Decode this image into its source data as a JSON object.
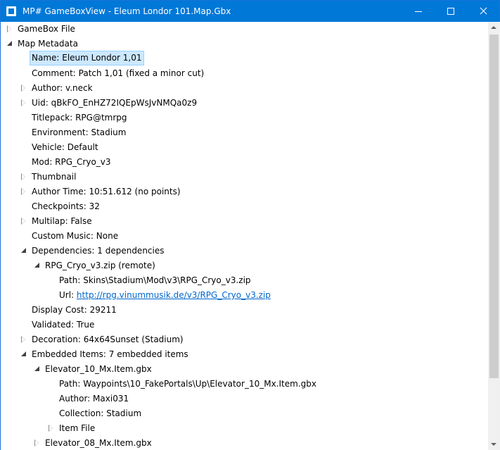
{
  "window": {
    "title": "MP# GameBoxView - Eleum Londor 101.Map.Gbx"
  },
  "tree": {
    "gamebox_file": "GameBox File",
    "map_metadata": "Map Metadata",
    "name": "Name: Eleum Londor 1,01",
    "comment": "Comment: Patch 1,01 (fixed a minor cut)",
    "author": "Author: v.neck",
    "uid": "Uid: qBkFO_EnHZ72IQEpWsJvNMQa0z9",
    "titlepack": "Titlepack: RPG@tmrpg",
    "environment": "Environment: Stadium",
    "vehicle": "Vehicle: Default",
    "mod": "Mod: RPG_Cryo_v3",
    "thumbnail": "Thumbnail",
    "author_time": "Author Time: 10:51.612 (no points)",
    "checkpoints": "Checkpoints: 32",
    "multilap": "Multilap: False",
    "custom_music": "Custom Music: None",
    "dependencies": "Dependencies: 1 dependencies",
    "dep_zip": "RPG_Cryo_v3.zip (remote)",
    "dep_path": "Path: Skins\\Stadium\\Mod\\v3\\RPG_Cryo_v3.zip",
    "dep_url_prefix": "Url: ",
    "dep_url": "http://rpg.vinummusik.de/v3/RPG_Cryo_v3.zip",
    "display_cost": "Display Cost: 29211",
    "validated": "Validated: True",
    "decoration": "Decoration: 64x64Sunset (Stadium)",
    "embedded_items": "Embedded Items: 7 embedded items",
    "item1": "Elevator_10_Mx.Item.gbx",
    "item1_path": "Path: Waypoints\\10_FakePortals\\Up\\Elevator_10_Mx.Item.gbx",
    "item1_author": "Author: Maxi031",
    "item1_collection": "Collection: Stadium",
    "item1_file": "Item File",
    "item2": "Elevator_08_Mx.Item.gbx"
  }
}
